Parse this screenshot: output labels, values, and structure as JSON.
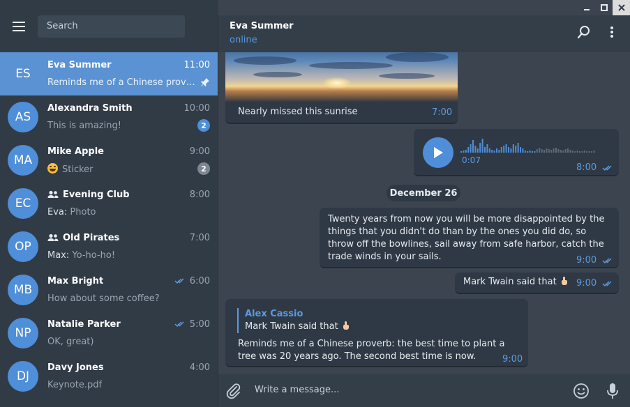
{
  "window": {
    "min_icon": "minimize-icon",
    "max_icon": "maximize-icon",
    "close_icon": "close-icon"
  },
  "sidebar": {
    "search_placeholder": "Search",
    "chats": [
      {
        "initials": "ES",
        "name": "Eva Summer",
        "time": "11:00",
        "preview": "Reminds me of a Chinese proverb: the best time to plant a tree was 20 years ago.",
        "pinned": true,
        "active": true
      },
      {
        "initials": "AS",
        "name": "Alexandra Smith",
        "time": "10:00",
        "preview": "This is amazing!",
        "badge": "2"
      },
      {
        "initials": "MA",
        "name": "Mike Apple",
        "time": "9:00",
        "preview": "Sticker",
        "badge": "2",
        "badge_muted": true,
        "emoji": true
      },
      {
        "initials": "EC",
        "name": "Evening Club",
        "time": "8:00",
        "sender": "Eva:",
        "preview": "Photo",
        "group": true
      },
      {
        "initials": "OP",
        "name": "Old Pirates",
        "time": "7:00",
        "sender": "Max:",
        "preview": "Yo-ho-ho!",
        "group": true
      },
      {
        "initials": "MB",
        "name": "Max Bright",
        "time": "6:00",
        "preview": "How about some coffee?",
        "read": true
      },
      {
        "initials": "NP",
        "name": "Natalie Parker",
        "time": "5:00",
        "preview": "OK, great)",
        "read": true
      },
      {
        "initials": "DJ",
        "name": "Davy Jones",
        "time": "4:00",
        "preview": "Keynote.pdf"
      }
    ]
  },
  "header": {
    "name": "Eva Summer",
    "status": "online"
  },
  "messages": {
    "photo_caption": "Nearly missed this sunrise",
    "photo_time": "7:00",
    "voice_duration": "0:07",
    "voice_time": "8:00",
    "date_separator": "December 26",
    "quote_text": "Twenty years from now you will be more disappointed by the things that you didn't do than by the ones you did do, so throw off the bowlines, sail away from safe harbor, catch the trade winds in your sails.",
    "quote_time": "9:00",
    "mark_text": "Mark Twain said that",
    "mark_time": "9:00",
    "reply_name": "Alex Cassio",
    "reply_quote": "Mark Twain said that",
    "reply_text": "Reminds me of a Chinese proverb: the best time to plant a tree was 20 years ago. The second best time is now.",
    "reply_time": "9:00"
  },
  "compose": {
    "placeholder": "Write a message..."
  },
  "colors": {
    "accent": "#4f8ed8",
    "active_row": "#5a92d3",
    "sidebar_bg": "#313b46",
    "chat_bg": "#3c4450",
    "bubble_bg": "#2f3945"
  }
}
